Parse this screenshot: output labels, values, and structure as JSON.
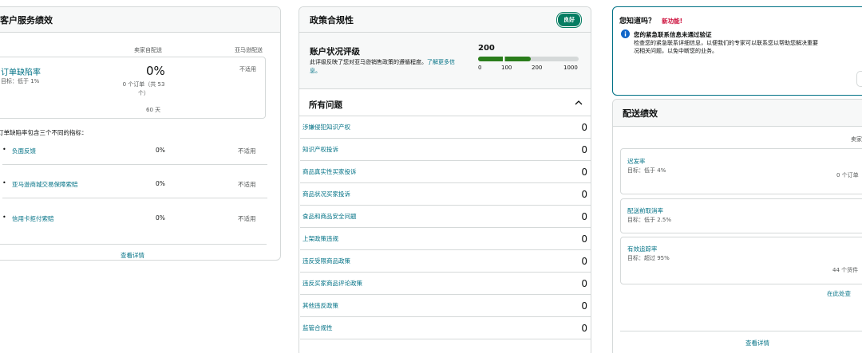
{
  "customer_service": {
    "title": "客户服务绩效",
    "col_seller": "卖家自配送",
    "col_amazon": "亚马逊配送",
    "odr": {
      "label": "订单缺陷率",
      "target": "目标：低于 1%",
      "value": "0%",
      "sub": "0 个订单（共 53 个）",
      "period": "60 天",
      "amazon_value": "不适用"
    },
    "metrics_intro": "订单缺陷率包含三个不同的指标：",
    "metrics": [
      {
        "label": "负面反馈",
        "value": "0%",
        "amazon": "不适用"
      },
      {
        "label": "亚马逊商城交易保障索赔",
        "value": "0%",
        "amazon": "不适用"
      },
      {
        "label": "信用卡拒付索赔",
        "value": "0%",
        "amazon": "不适用"
      }
    ],
    "details_link": "查看详情"
  },
  "policy": {
    "title": "政策合规性",
    "badge": "良好",
    "ahr": {
      "title": "账户状况评级",
      "desc": "此评级反映了您对亚马逊销售政策的遵循程度。",
      "learn_more": "了解更多信息。",
      "score": "200",
      "scale": [
        "0",
        "100",
        "200",
        "1000"
      ],
      "level_fraction": 0.2
    },
    "issues_title": "所有问题",
    "issues": [
      {
        "label": "涉嫌侵犯知识产权",
        "value": "0"
      },
      {
        "label": "知识产权投诉",
        "value": "0"
      },
      {
        "label": "商品真实性买家投诉",
        "value": "0"
      },
      {
        "label": "商品状况买家投诉",
        "value": "0"
      },
      {
        "label": "食品和商品安全问题",
        "value": "0"
      },
      {
        "label": "上架政策违规",
        "value": "0"
      },
      {
        "label": "违反受限商品政策",
        "value": "0"
      },
      {
        "label": "违反买家商品评论政策",
        "value": "0"
      },
      {
        "label": "其他违反政策",
        "value": "0"
      },
      {
        "label": "监管合规性",
        "value": "0"
      }
    ]
  },
  "notice": {
    "title": "您知道吗？",
    "new_label": "新功能!",
    "heading": "您的紧急联系信息未通过验证",
    "line1": "检查您的紧急联系详细信息，以便我们的专家可以联系您以帮助您解决重要",
    "line2": "况相关问题，以免中断您的业务。"
  },
  "shipping": {
    "title": "配送绩效",
    "col_seller": "卖家",
    "metrics": [
      {
        "label": "迟发率",
        "target": "目标：低于 4%",
        "sub": "0 个订单（"
      },
      {
        "label": "配送前取消率",
        "target": "目标：低于 2.5%",
        "sub": ""
      },
      {
        "label": "有效追踪率",
        "target": "目标：超过 95%",
        "sub": "44 个货件（"
      }
    ],
    "view_here": "在此处查",
    "details_link": "查看详情"
  }
}
